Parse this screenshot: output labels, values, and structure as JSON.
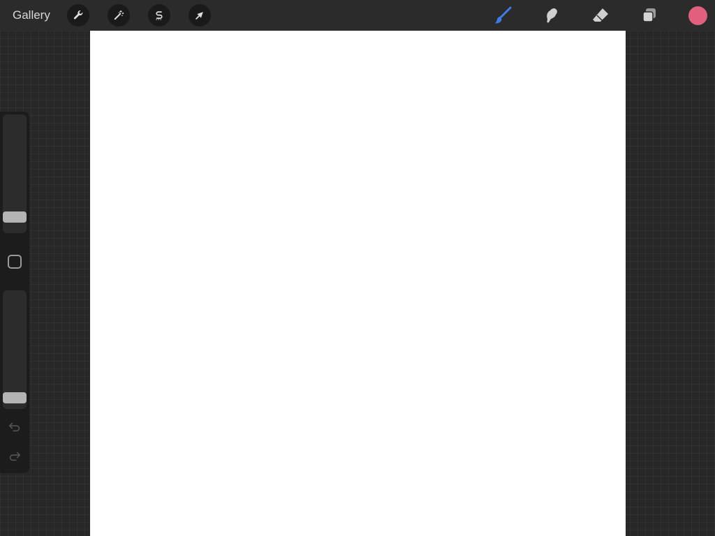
{
  "topbar": {
    "gallery_label": "Gallery",
    "actions": [
      {
        "name": "actions-button",
        "icon": "wrench-icon"
      },
      {
        "name": "adjustments-button",
        "icon": "magic-wand-icon"
      },
      {
        "name": "selection-button",
        "icon": "selection-s-icon"
      },
      {
        "name": "transform-button",
        "icon": "arrow-cursor-icon"
      }
    ],
    "tools": [
      {
        "name": "brush-tool",
        "icon": "brush-icon",
        "active": true
      },
      {
        "name": "smudge-tool",
        "icon": "smudge-icon",
        "active": false
      },
      {
        "name": "eraser-tool",
        "icon": "eraser-icon",
        "active": false
      },
      {
        "name": "layers-button",
        "icon": "layers-icon",
        "active": false
      }
    ],
    "current_color": "#e0607e",
    "active_tool_color": "#3b7ee6"
  },
  "sidebar": {
    "brush_size_level": 0.1,
    "opacity_level": 0.05,
    "modify_icon": "square-icon",
    "undo_icon": "undo-icon",
    "redo_icon": "redo-icon"
  }
}
